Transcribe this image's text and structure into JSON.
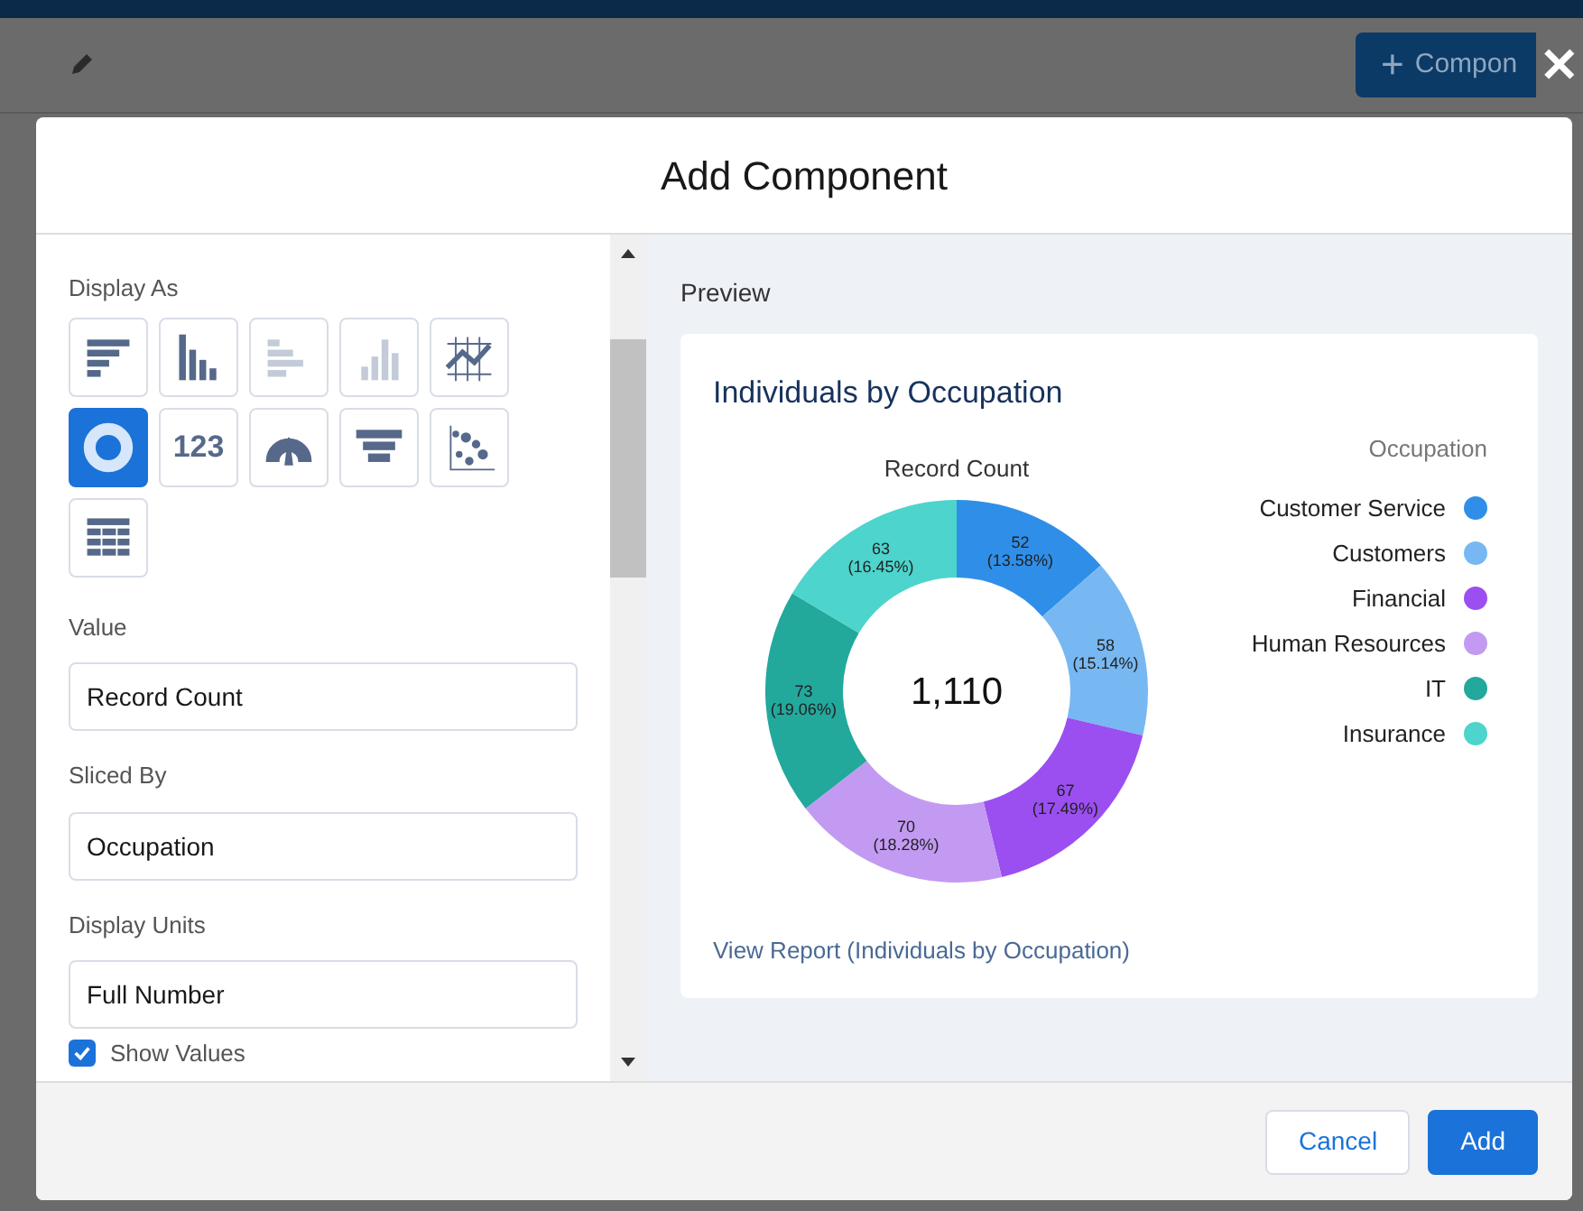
{
  "background": {
    "add_button": {
      "icon": "+",
      "label": "Compon"
    }
  },
  "close_label": "✕",
  "modal": {
    "title": "Add Component",
    "display_as": {
      "label": "Display As",
      "options": [
        {
          "kind": "hbar",
          "selected": false,
          "disabled": false
        },
        {
          "kind": "vbar",
          "selected": false,
          "disabled": false
        },
        {
          "kind": "hstack",
          "selected": false,
          "disabled": true
        },
        {
          "kind": "vstack",
          "selected": false,
          "disabled": true
        },
        {
          "kind": "line",
          "selected": false,
          "disabled": false
        },
        {
          "kind": "donut",
          "selected": true,
          "disabled": false
        },
        {
          "kind": "metric",
          "selected": false,
          "disabled": false,
          "text": "123"
        },
        {
          "kind": "gauge",
          "selected": false,
          "disabled": false
        },
        {
          "kind": "funnel",
          "selected": false,
          "disabled": false
        },
        {
          "kind": "scatter",
          "selected": false,
          "disabled": false
        },
        {
          "kind": "table",
          "selected": false,
          "disabled": false
        }
      ]
    },
    "fields": [
      {
        "label": "Value",
        "value": "Record Count"
      },
      {
        "label": "Sliced By",
        "value": "Occupation"
      },
      {
        "label": "Display Units",
        "value": "Full Number"
      }
    ],
    "show_values": {
      "label": "Show Values",
      "checked": true
    },
    "preview": {
      "label": "Preview",
      "title": "Individuals by Occupation",
      "center_total": "1,110",
      "legend_title": "Occupation",
      "link": "View Report (Individuals by Occupation)",
      "chart_data": {
        "type": "donut",
        "title": "Record Count",
        "categories": [
          "Customer Service",
          "Customers",
          "Financial",
          "Human Resources",
          "IT",
          "Insurance"
        ],
        "values": [
          13.58,
          15.14,
          17.49,
          18.28,
          19.06,
          16.45
        ],
        "colors": [
          "#2f8fe8",
          "#78b8f2",
          "#9b4ff0",
          "#c39af2",
          "#23a89c",
          "#4dd4cc"
        ],
        "value_labels": [
          [
            "52",
            "(13.58%)"
          ],
          [
            "58",
            "(15.14%)"
          ],
          [
            "67",
            "(17.49%)"
          ],
          [
            "70",
            "(18.28%)"
          ],
          [
            "73",
            "(19.06%)"
          ],
          [
            "63",
            "(16.45%)"
          ]
        ]
      }
    },
    "buttons": [
      {
        "kind": "neutral",
        "label": "Cancel"
      },
      {
        "kind": "brand",
        "label": "Add"
      }
    ]
  }
}
